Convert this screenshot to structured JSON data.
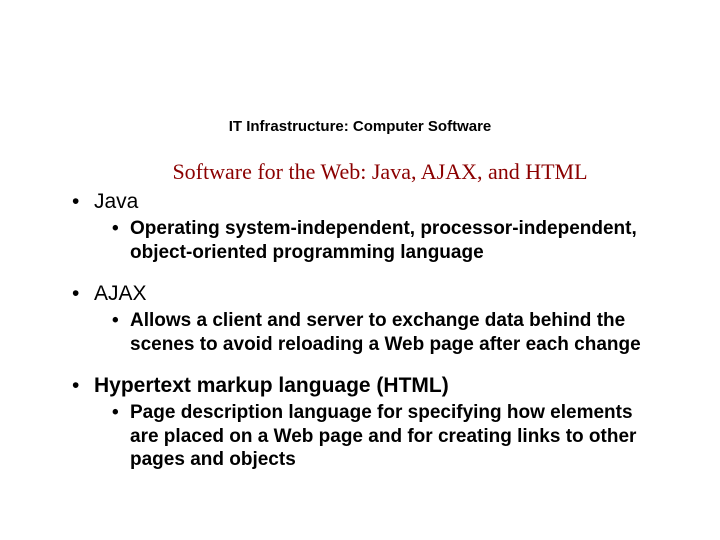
{
  "header": "IT Infrastructure: Computer Software",
  "title": "Software for the Web: Java, AJAX, and HTML",
  "bullets": [
    {
      "label": "Java",
      "sub": "Operating system-independent, processor-independent, object-oriented programming language"
    },
    {
      "label": "AJAX",
      "sub": "Allows a client and server to exchange data behind the scenes to avoid reloading a Web page after each change"
    },
    {
      "label": "Hypertext markup language (HTML)",
      "sub": "Page description language for specifying how elements are placed on a Web page and for creating links to other pages and objects"
    }
  ]
}
